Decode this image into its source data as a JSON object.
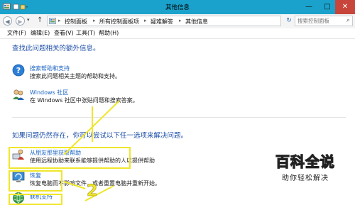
{
  "window": {
    "title": "其他信息",
    "minimize": "—",
    "maximize": "□",
    "close": "✕"
  },
  "nav": {
    "back": "◀",
    "forward": "▶",
    "up": "↑"
  },
  "address": {
    "crumbs": [
      "控制面板",
      "所有控制面板项",
      "疑难解答",
      "其他信息"
    ],
    "separator": "▸",
    "refresh": "↻"
  },
  "search": {
    "placeholder": "搜索控制面板"
  },
  "menu": {
    "items": [
      "文件(F)",
      "编辑(E)",
      "查看(V)",
      "工具(T)",
      "帮助(H)"
    ]
  },
  "main": {
    "heading1": "查找此问题相关的额外信息。",
    "items1": [
      {
        "title": "搜索帮助和支持",
        "desc": "搜索此问题相关主题的帮助和支持。"
      },
      {
        "title": "Windows 社区",
        "desc": "在 Windows 社区中张贴问题和搜索答案。"
      }
    ],
    "heading2": "如果问题仍然存在，你可以尝试以下任一选项来解决问题。",
    "items2": [
      {
        "title": "从朋友那里获取帮助",
        "desc": "使用远程协助来联系能够提供帮助的人以提供帮助"
      },
      {
        "title": "恢复",
        "desc": "恢复电脑而不影响文件，或者重置电脑并重新开始。"
      },
      {
        "title": "联机支持",
        "desc": ""
      }
    ]
  },
  "annotations": {
    "number": "2",
    "colors": {
      "highlight": "#f0e62a",
      "titlebar": "#1aa2cc",
      "link": "#1c65c2",
      "heading": "#1e4fa8",
      "close": "#c7453a"
    }
  },
  "watermark": {
    "brand": "百科全说",
    "slogan": "助你轻松解决"
  }
}
